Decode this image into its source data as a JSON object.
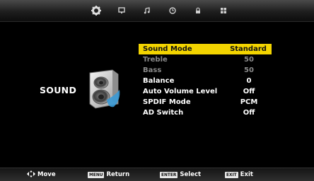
{
  "top_tabs": [
    {
      "name": "picture",
      "icon": "gear-icon"
    },
    {
      "name": "screen",
      "icon": "monitor-icon"
    },
    {
      "name": "sound",
      "icon": "music-note-icon"
    },
    {
      "name": "time",
      "icon": "clock-icon"
    },
    {
      "name": "lock",
      "icon": "lock-icon"
    },
    {
      "name": "options",
      "icon": "grid-icon"
    }
  ],
  "active_tab_index": 0,
  "section": {
    "title": "SOUND"
  },
  "menu": {
    "items": [
      {
        "label": "Sound Mode",
        "value": "Standard",
        "state": "selected"
      },
      {
        "label": "Treble",
        "value": "50",
        "state": "disabled"
      },
      {
        "label": "Bass",
        "value": "50",
        "state": "disabled"
      },
      {
        "label": "Balance",
        "value": "0",
        "state": "normal"
      },
      {
        "label": "Auto Volume Level",
        "value": "Off",
        "state": "normal"
      },
      {
        "label": "SPDIF Mode",
        "value": "PCM",
        "state": "normal"
      },
      {
        "label": "AD Switch",
        "value": "Off",
        "state": "normal"
      }
    ]
  },
  "footer": {
    "move": {
      "label": "Move"
    },
    "return": {
      "key": "MENU",
      "label": "Return"
    },
    "select": {
      "key": "ENTER",
      "label": "Select"
    },
    "exit": {
      "key": "EXIT",
      "label": "Exit"
    }
  },
  "colors": {
    "highlight": "#f3d400",
    "disabled_text": "#8a8a8a",
    "background": "#000000"
  }
}
